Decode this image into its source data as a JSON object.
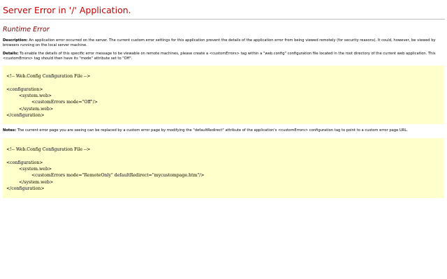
{
  "page": {
    "title": "Server Error in '/' Application.",
    "subtitle": "Runtime Error",
    "title_color": "#cc0000",
    "subtitle_color": "#800000",
    "code_background": "#ffffcc"
  },
  "description": {
    "label": "Description:",
    "text": " An application error occurred on the server. The current custom error settings for this application prevent the details of the application error from being viewed remotely (for security reasons). It could, however, be viewed by browsers running on the local server machine."
  },
  "details": {
    "label": "Details:",
    "text": " To enable the details of this specific error message to be viewable on remote machines, please create a <customErrors> tag within a \"web.config\" configuration file located in the root directory of the current web application. This <customErrors> tag should then have its \"mode\" attribute set to \"Off\"."
  },
  "code1": {
    "lines": [
      "<!-- Web.Config Configuration File -->",
      "<configuration>",
      "<system.web>",
      "<customErrors mode=\"Off\"/>",
      "</system.web>",
      "</configuration>"
    ]
  },
  "notes": {
    "label": "Notes:",
    "text": " The current error page you are seeing can be replaced by a custom error page by modifying the \"defaultRedirect\" attribute of the application's <customErrors> configuration tag to point to a custom error page URL."
  },
  "code2": {
    "lines": [
      "<!-- Web.Config Configuration File -->",
      "<configuration>",
      "<system.web>",
      "<customErrors mode=\"RemoteOnly\" defaultRedirect=\"mycustompage.htm\"/>",
      "</system.web>",
      "</configuration>"
    ]
  }
}
